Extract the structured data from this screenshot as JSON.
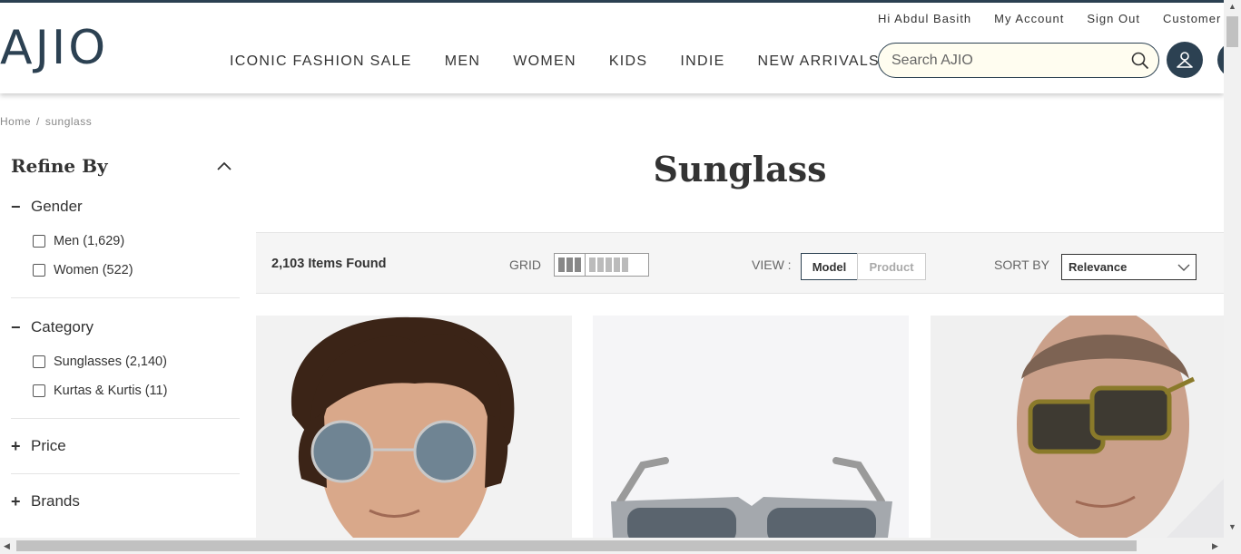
{
  "header": {
    "logo": "AJIO",
    "util_links": [
      "Hi Abdul Basith",
      "My Account",
      "Sign Out",
      "Customer"
    ],
    "nav": [
      "ICONIC FASHION SALE",
      "MEN",
      "WOMEN",
      "KIDS",
      "INDIE",
      "NEW ARRIVALS"
    ],
    "search_placeholder": "Search AJIO"
  },
  "breadcrumb": {
    "home": "Home",
    "sep": "/",
    "current": "sunglass"
  },
  "sidebar": {
    "title": "Refine By",
    "facets": [
      {
        "name": "Gender",
        "sign": "−",
        "options": [
          "Men (1,629)",
          "Women (522)"
        ]
      },
      {
        "name": "Category",
        "sign": "−",
        "options": [
          "Sunglasses (2,140)",
          "Kurtas & Kurtis (11)"
        ]
      },
      {
        "name": "Price",
        "sign": "+"
      },
      {
        "name": "Brands",
        "sign": "+"
      }
    ]
  },
  "main": {
    "title": "Sunglass",
    "items_found": "2,103 Items Found",
    "grid_label": "GRID",
    "view_label": "VIEW :",
    "view_model": "Model",
    "view_product": "Product",
    "sort_label": "SORT BY",
    "sort_value": "Relevance"
  },
  "colors": {
    "brand": "#2c4152",
    "search_bg": "#fffdf0"
  }
}
